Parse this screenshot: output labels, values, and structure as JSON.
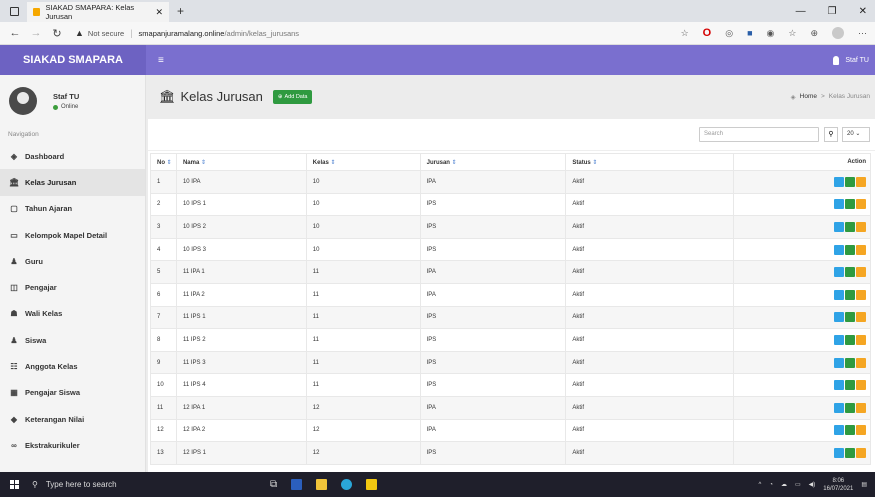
{
  "browser": {
    "tab_title": "SIAKAD SMAPARA: Kelas Jurusan",
    "security": "Not secure",
    "url_host": "smapanjuramalang.online",
    "url_path": "/admin/kelas_jurusans"
  },
  "header": {
    "brand": "SIAKAD SMAPARA",
    "user": "Staf TU"
  },
  "sidebar": {
    "user_name": "Staf TU",
    "user_status": "Online",
    "nav_header": "Navigation",
    "items": [
      {
        "label": "Dashboard",
        "icon": "dashboard-icon"
      },
      {
        "label": "Kelas Jurusan",
        "icon": "institution-icon",
        "active": true
      },
      {
        "label": "Tahun Ajaran",
        "icon": "calendar-icon"
      },
      {
        "label": "Kelompok Mapel Detail",
        "icon": "folder-icon"
      },
      {
        "label": "Guru",
        "icon": "user-icon"
      },
      {
        "label": "Pengajar",
        "icon": "presentation-icon"
      },
      {
        "label": "Wali Kelas",
        "icon": "users-icon"
      },
      {
        "label": "Siswa",
        "icon": "user-icon"
      },
      {
        "label": "Anggota Kelas",
        "icon": "group-icon"
      },
      {
        "label": "Pengajar Siswa",
        "icon": "table-icon"
      },
      {
        "label": "Keterangan Nilai",
        "icon": "tag-icon"
      },
      {
        "label": "Ekstrakurikuler",
        "icon": "infinity-icon"
      }
    ]
  },
  "content": {
    "title": "Kelas Jurusan",
    "add_button": "Add Data",
    "breadcrumb_home": "Home",
    "breadcrumb_current": "Kelas Jurusan",
    "search_placeholder": "Search",
    "page_size": "20",
    "columns": [
      "No",
      "Nama",
      "Kelas",
      "Jurusan",
      "Status",
      "Action"
    ],
    "rows": [
      [
        "1",
        "10 IPA",
        "10",
        "IPA",
        "Aktif"
      ],
      [
        "2",
        "10 IPS 1",
        "10",
        "IPS",
        "Aktif"
      ],
      [
        "3",
        "10 IPS 2",
        "10",
        "IPS",
        "Aktif"
      ],
      [
        "4",
        "10 IPS 3",
        "10",
        "IPS",
        "Aktif"
      ],
      [
        "5",
        "11 IPA 1",
        "11",
        "IPA",
        "Aktif"
      ],
      [
        "6",
        "11 IPA 2",
        "11",
        "IPA",
        "Aktif"
      ],
      [
        "7",
        "11 IPS 1",
        "11",
        "IPS",
        "Aktif"
      ],
      [
        "8",
        "11 IPS 2",
        "11",
        "IPS",
        "Aktif"
      ],
      [
        "9",
        "11 IPS 3",
        "11",
        "IPS",
        "Aktif"
      ],
      [
        "10",
        "11 IPS 4",
        "11",
        "IPS",
        "Aktif"
      ],
      [
        "11",
        "12 IPA 1",
        "12",
        "IPA",
        "Aktif"
      ],
      [
        "12",
        "12 IPA 2",
        "12",
        "IPA",
        "Aktif"
      ],
      [
        "13",
        "12 IPS 1",
        "12",
        "IPS",
        "Aktif"
      ]
    ]
  },
  "taskbar": {
    "search_placeholder": "Type here to search",
    "time": "8:06",
    "date": "16/07/2021"
  },
  "colors": {
    "header": "#7a6fcf",
    "brand_bg": "#6d62c2",
    "view_button": "#2fa3e6",
    "edit_button": "#2f9a40",
    "delete_button": "#f5a623"
  }
}
